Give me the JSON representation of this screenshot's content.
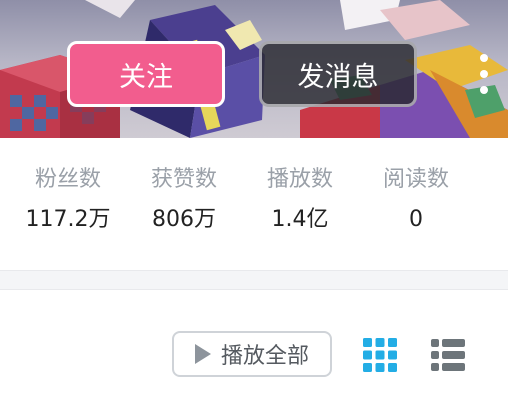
{
  "header": {
    "follow_label": "关注",
    "message_label": "发消息",
    "more_icon": "more-vertical-icon"
  },
  "stats": [
    {
      "label": "粉丝数",
      "value": "117.2万"
    },
    {
      "label": "获赞数",
      "value": "806万"
    },
    {
      "label": "播放数",
      "value": "1.4亿"
    },
    {
      "label": "阅读数",
      "value": "0"
    }
  ],
  "toolbar": {
    "play_all_label": "播放全部",
    "play_icon": "play-icon",
    "grid_icon": "grid-view-icon",
    "list_icon": "list-view-icon",
    "active_color": "#23ade5",
    "inactive_color": "#6d757a"
  },
  "colors": {
    "follow_button": "#f25d8e"
  }
}
